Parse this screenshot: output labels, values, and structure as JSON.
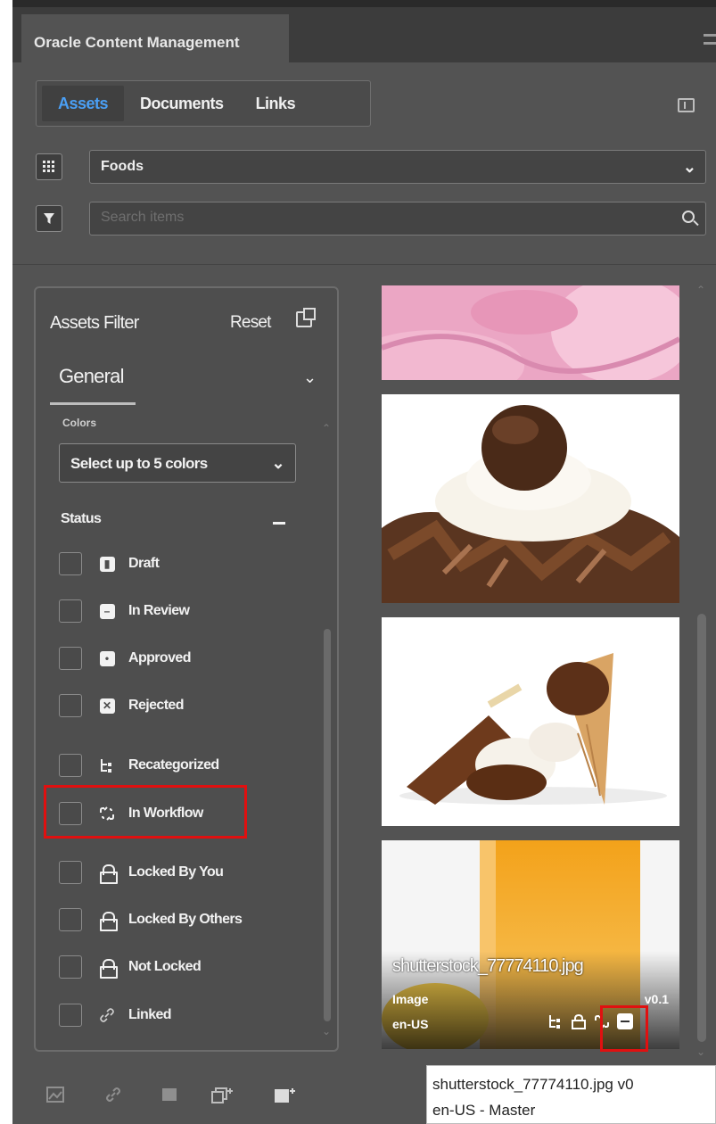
{
  "app": {
    "title": "Oracle Content Management"
  },
  "tabs": [
    {
      "label": "Assets",
      "active": true
    },
    {
      "label": "Documents",
      "active": false
    },
    {
      "label": "Links",
      "active": false
    }
  ],
  "repository": {
    "selected": "Foods"
  },
  "search": {
    "placeholder": "Search items",
    "value": ""
  },
  "filter": {
    "title": "Assets Filter",
    "reset_label": "Reset",
    "section": "General",
    "colors_label": "Colors",
    "colors_select": "Select up to 5 colors",
    "status_label": "Status",
    "options": [
      {
        "label": "Draft",
        "icon": "draft-icon",
        "checked": false
      },
      {
        "label": "In Review",
        "icon": "in-review-icon",
        "checked": false
      },
      {
        "label": "Approved",
        "icon": "approved-icon",
        "checked": false
      },
      {
        "label": "Rejected",
        "icon": "rejected-icon",
        "checked": false
      },
      {
        "label": "Recategorized",
        "icon": "recategorized-icon",
        "checked": false
      },
      {
        "label": "In Workflow",
        "icon": "workflow-icon",
        "checked": false,
        "highlighted": true
      },
      {
        "label": "Locked By You",
        "icon": "lock-icon",
        "checked": false
      },
      {
        "label": "Locked By Others",
        "icon": "lock-icon",
        "checked": false
      },
      {
        "label": "Not Locked",
        "icon": "lock-icon",
        "checked": false
      },
      {
        "label": "Linked",
        "icon": "link-icon",
        "checked": false
      }
    ]
  },
  "assets": [
    {
      "image": "pink-ice-cream"
    },
    {
      "image": "chocolate-dessert"
    },
    {
      "image": "ice-cream-bars"
    },
    {
      "image": "orange-juice",
      "name": "shutterstock_77774110.jpg",
      "type": "Image",
      "version": "v0.1",
      "locale": "en-US"
    }
  ],
  "tooltip": {
    "line1": "shutterstock_77774110.jpg  v0",
    "line2": "en-US - Master"
  },
  "colors": {
    "accent": "#4a9ff5",
    "highlight": "#e01010",
    "panel": "#535353"
  }
}
